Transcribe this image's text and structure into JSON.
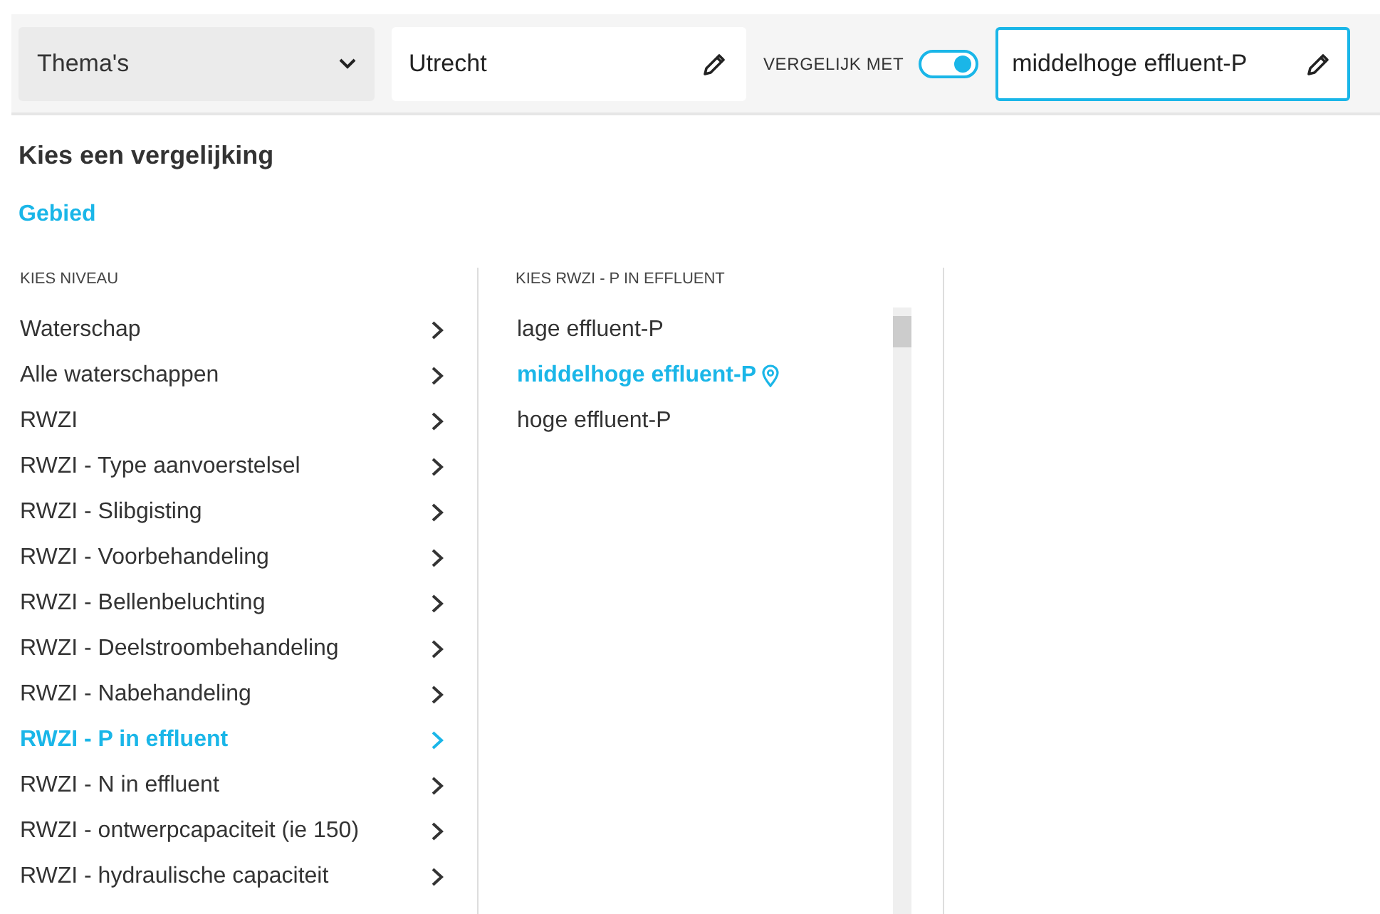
{
  "toolbar": {
    "theme_dropdown": {
      "value": "Thema's"
    },
    "area_field": {
      "value": "Utrecht"
    },
    "compare_label": "VERGELIJK MET",
    "compare_toggle": {
      "on": true
    },
    "compare_field": {
      "value": "middelhoge effluent-P",
      "focused": true
    }
  },
  "panel": {
    "title": "Kies een vergelijking",
    "tab": "Gebied",
    "levels": {
      "heading": "KIES NIVEAU",
      "items": [
        {
          "label": "Waterschap",
          "selected": false
        },
        {
          "label": "Alle waterschappen",
          "selected": false
        },
        {
          "label": "RWZI",
          "selected": false
        },
        {
          "label": "RWZI - Type aanvoerstelsel",
          "selected": false
        },
        {
          "label": "RWZI - Slibgisting",
          "selected": false
        },
        {
          "label": "RWZI - Voorbehandeling",
          "selected": false
        },
        {
          "label": "RWZI - Bellenbeluchting",
          "selected": false
        },
        {
          "label": "RWZI - Deelstroombehandeling",
          "selected": false
        },
        {
          "label": "RWZI - Nabehandeling",
          "selected": false
        },
        {
          "label": "RWZI - P in effluent",
          "selected": true
        },
        {
          "label": "RWZI - N in effluent",
          "selected": false
        },
        {
          "label": "RWZI - ontwerpcapaciteit (ie 150)",
          "selected": false
        },
        {
          "label": "RWZI - hydraulische capaciteit",
          "selected": false
        }
      ]
    },
    "options": {
      "heading": "KIES RWZI - P IN EFFLUENT",
      "items": [
        {
          "label": "lage effluent-P",
          "selected": false
        },
        {
          "label": "middelhoge effluent-P",
          "selected": true
        },
        {
          "label": "hoge effluent-P",
          "selected": false
        }
      ]
    }
  }
}
